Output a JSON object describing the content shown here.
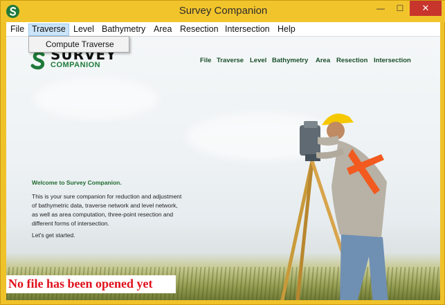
{
  "window": {
    "title": "Survey Companion",
    "min_glyph": "—",
    "max_glyph": "☐",
    "close_glyph": "✕"
  },
  "menubar": {
    "items": [
      "File",
      "Traverse",
      "Level",
      "Bathymetry",
      "Area",
      "Resection",
      "Intersection",
      "Help"
    ],
    "active": "Traverse"
  },
  "dropdown": {
    "items": [
      "Compute Traverse"
    ]
  },
  "banner": {
    "logo_top": "SURVEY",
    "logo_bottom": "COMPANION",
    "nav": [
      "File",
      "Traverse",
      "Level",
      "Bathymetry",
      "Area",
      "Resection",
      "Intersection"
    ]
  },
  "welcome": {
    "title": "Welcome to Survey Companion.",
    "lines": [
      "This is your sure companion for reduction and adjustment",
      "of bathymetric data, traverse network and level network,",
      "as well as area computation, three-point resection and",
      "different forms of intersection."
    ],
    "closing": "Let's get started."
  },
  "status": {
    "text": "No file has been opened yet",
    "color": "#e0101a"
  },
  "colors": {
    "frame": "#f2c42c",
    "close": "#c7352c",
    "brand_green": "#1f7a3a",
    "menu_active": "#cce4f7"
  }
}
